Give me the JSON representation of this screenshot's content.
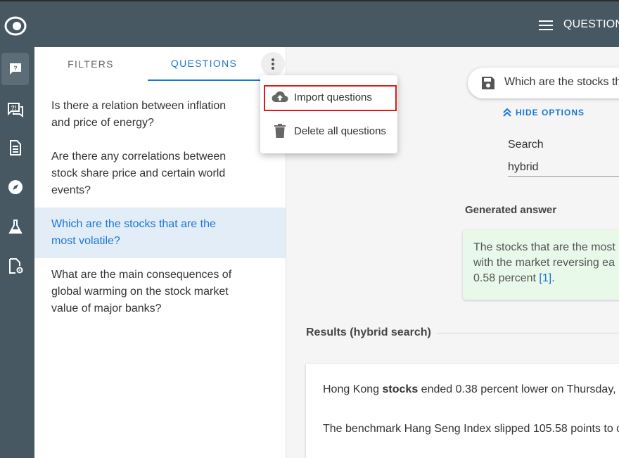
{
  "topbar": {
    "title": "QUESTION"
  },
  "rail": {
    "items": [
      "question-icon",
      "forum-icon",
      "document-icon",
      "compass-icon",
      "flask-icon",
      "file-settings-icon"
    ]
  },
  "tabs": {
    "filters": "FILTERS",
    "questions": "QUESTIONS"
  },
  "questions": [
    "Is there a relation between inflation and price of energy?",
    "Are there any correlations between stock share price and certain world events?",
    "Which are the stocks that are the most volatile?",
    "What are the main consequences of global warming on the stock market value of major banks?"
  ],
  "menu": {
    "import": "Import questions",
    "delete": "Delete all questions"
  },
  "main": {
    "question_text": "Which are the stocks th",
    "hide_options": "HIDE OPTIONS",
    "search_label": "Search",
    "search_value": "hybrid",
    "generated_label": "Generated answer",
    "answer_line1": "The stocks that are the most",
    "answer_line2": "with the market reversing ea",
    "answer_line3a": "0.58 percent ",
    "answer_ref": "[1]",
    "answer_line3b": ".",
    "results_label": "Results (hybrid search)",
    "result1_pre": "Hong Kong ",
    "result1_bold": "stocks",
    "result1_post": " ended 0.38 percent lower on Thursday, b",
    "result2": "The benchmark Hang Seng Index slipped 105.58 points to c"
  },
  "colors": {
    "accent": "#1976d2",
    "sidebar": "#485862",
    "highlight": "#e01919",
    "answer_bg": "#e8f9e9"
  }
}
